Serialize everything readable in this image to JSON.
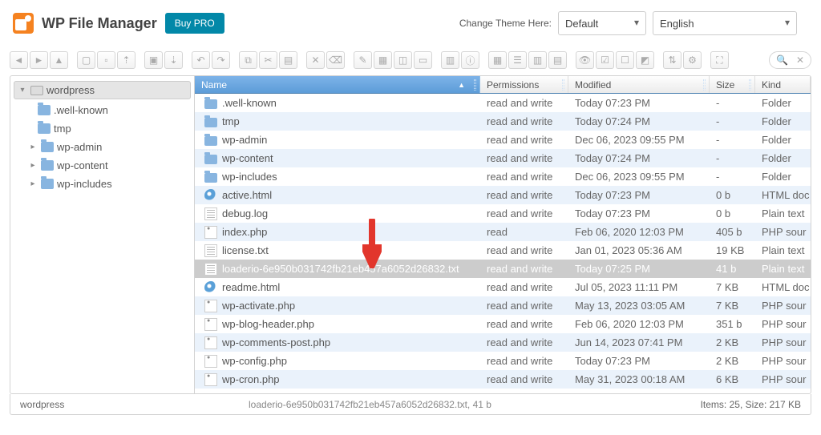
{
  "header": {
    "title": "WP File Manager",
    "buy_pro": "Buy PRO",
    "theme_label": "Change Theme Here:",
    "theme_value": "Default",
    "lang_value": "English"
  },
  "tree": {
    "root": "wordpress",
    "items": [
      {
        "label": ".well-known",
        "expandable": false
      },
      {
        "label": "tmp",
        "expandable": false
      },
      {
        "label": "wp-admin",
        "expandable": true
      },
      {
        "label": "wp-content",
        "expandable": true
      },
      {
        "label": "wp-includes",
        "expandable": true
      }
    ]
  },
  "columns": {
    "name": "Name",
    "perm": "Permissions",
    "mod": "Modified",
    "size": "Size",
    "kind": "Kind"
  },
  "files": [
    {
      "icon": "folder",
      "name": ".well-known",
      "perm": "read and write",
      "mod": "Today 07:23 PM",
      "size": "-",
      "kind": "Folder",
      "selected": false
    },
    {
      "icon": "folder",
      "name": "tmp",
      "perm": "read and write",
      "mod": "Today 07:24 PM",
      "size": "-",
      "kind": "Folder",
      "selected": false
    },
    {
      "icon": "folder",
      "name": "wp-admin",
      "perm": "read and write",
      "mod": "Dec 06, 2023 09:55 PM",
      "size": "-",
      "kind": "Folder",
      "selected": false
    },
    {
      "icon": "folder",
      "name": "wp-content",
      "perm": "read and write",
      "mod": "Today 07:24 PM",
      "size": "-",
      "kind": "Folder",
      "selected": false
    },
    {
      "icon": "folder",
      "name": "wp-includes",
      "perm": "read and write",
      "mod": "Dec 06, 2023 09:55 PM",
      "size": "-",
      "kind": "Folder",
      "selected": false
    },
    {
      "icon": "html",
      "name": "active.html",
      "perm": "read and write",
      "mod": "Today 07:23 PM",
      "size": "0 b",
      "kind": "HTML doc",
      "selected": false
    },
    {
      "icon": "txt",
      "name": "debug.log",
      "perm": "read and write",
      "mod": "Today 07:23 PM",
      "size": "0 b",
      "kind": "Plain text",
      "selected": false
    },
    {
      "icon": "php",
      "name": "index.php",
      "perm": "read",
      "mod": "Feb 06, 2020 12:03 PM",
      "size": "405 b",
      "kind": "PHP sour",
      "selected": false
    },
    {
      "icon": "txt",
      "name": "license.txt",
      "perm": "read and write",
      "mod": "Jan 01, 2023 05:36 AM",
      "size": "19 KB",
      "kind": "Plain text",
      "selected": false
    },
    {
      "icon": "txt",
      "name": "loaderio-6e950b031742fb21eb457a6052d26832.txt",
      "perm": "read and write",
      "mod": "Today 07:25 PM",
      "size": "41 b",
      "kind": "Plain text",
      "selected": true
    },
    {
      "icon": "html",
      "name": "readme.html",
      "perm": "read and write",
      "mod": "Jul 05, 2023 11:11 PM",
      "size": "7 KB",
      "kind": "HTML doc",
      "selected": false
    },
    {
      "icon": "php",
      "name": "wp-activate.php",
      "perm": "read and write",
      "mod": "May 13, 2023 03:05 AM",
      "size": "7 KB",
      "kind": "PHP sour",
      "selected": false
    },
    {
      "icon": "php",
      "name": "wp-blog-header.php",
      "perm": "read and write",
      "mod": "Feb 06, 2020 12:03 PM",
      "size": "351 b",
      "kind": "PHP sour",
      "selected": false
    },
    {
      "icon": "php",
      "name": "wp-comments-post.php",
      "perm": "read and write",
      "mod": "Jun 14, 2023 07:41 PM",
      "size": "2 KB",
      "kind": "PHP sour",
      "selected": false
    },
    {
      "icon": "php",
      "name": "wp-config.php",
      "perm": "read and write",
      "mod": "Today 07:23 PM",
      "size": "2 KB",
      "kind": "PHP sour",
      "selected": false
    },
    {
      "icon": "php",
      "name": "wp-cron.php",
      "perm": "read and write",
      "mod": "May 31, 2023 00:18 AM",
      "size": "6 KB",
      "kind": "PHP sour",
      "selected": false
    }
  ],
  "status": {
    "path": "wordpress",
    "selection": "loaderio-6e950b031742fb21eb457a6052d26832.txt, 41 b",
    "summary": "Items: 25, Size: 217 KB"
  }
}
